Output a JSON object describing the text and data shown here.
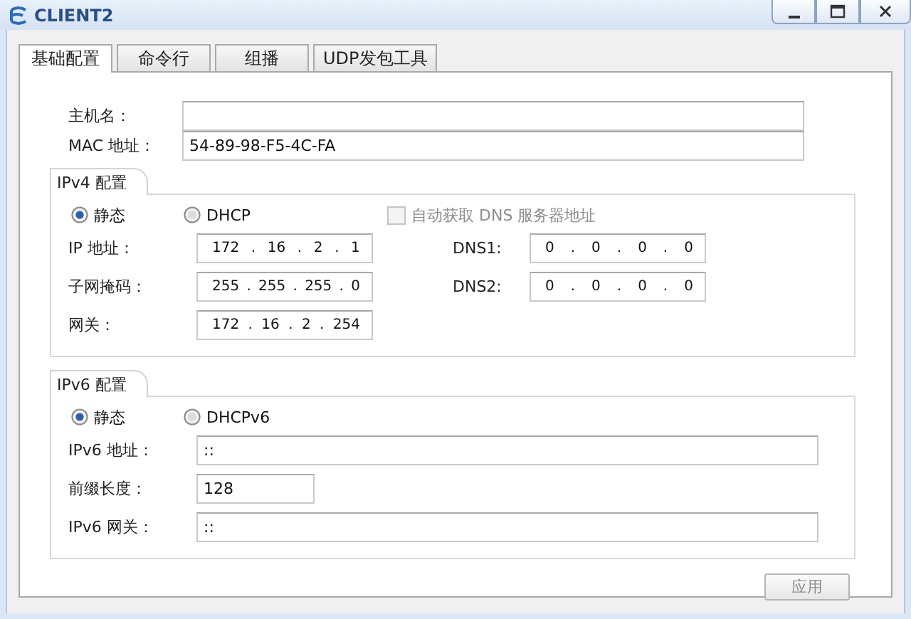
{
  "window": {
    "title": "CLIENT2"
  },
  "tabs": [
    {
      "label": "基础配置",
      "selected": true
    },
    {
      "label": "命令行",
      "selected": false
    },
    {
      "label": "组播",
      "selected": false
    },
    {
      "label": "UDP发包工具",
      "selected": false
    }
  ],
  "general": [
    {
      "label": "主机名：",
      "kind": "text"
    },
    {
      "label": "MAC 地址：",
      "kind": "text",
      "value": "54-89-98-F5-4C-FA"
    }
  ],
  "ipv4": {
    "title": "IPv4 配置",
    "modes": [
      {
        "label": "静态",
        "selected": true
      },
      {
        "label": "DHCP",
        "selected": false
      }
    ],
    "auto_dns": {
      "label": "自动获取 DNS 服务器地址",
      "checked": false,
      "disabled": true
    },
    "left_fields": [
      {
        "label": "IP 地址：",
        "kind": "ip",
        "value": "172 . 16 . 2 . 1"
      },
      {
        "label": "子网掩码：",
        "kind": "ip",
        "value": "255 . 255 . 255 . 0"
      },
      {
        "label": "网关：",
        "kind": "ip",
        "value": "172 . 16 . 2 . 254"
      }
    ],
    "right_fields": [
      {
        "label": "DNS1:",
        "kind": "ip",
        "value": "0 . 0 . 0 . 0"
      },
      {
        "label": "DNS2:",
        "kind": "ip",
        "value": "0 . 0 . 0 . 0"
      }
    ]
  },
  "ipv6": {
    "title": "IPv6 配置",
    "modes": [
      {
        "label": "静态",
        "selected": true
      },
      {
        "label": "DHCPv6",
        "selected": false
      }
    ],
    "fields": [
      {
        "label": "IPv6 地址：",
        "kind": "text",
        "value": "::"
      },
      {
        "label": "前缀长度：",
        "kind": "short",
        "value": "128"
      },
      {
        "label": "IPv6 网关：",
        "kind": "text",
        "value": "::"
      }
    ]
  },
  "apply_button": {
    "label": "应用",
    "disabled": true
  }
}
